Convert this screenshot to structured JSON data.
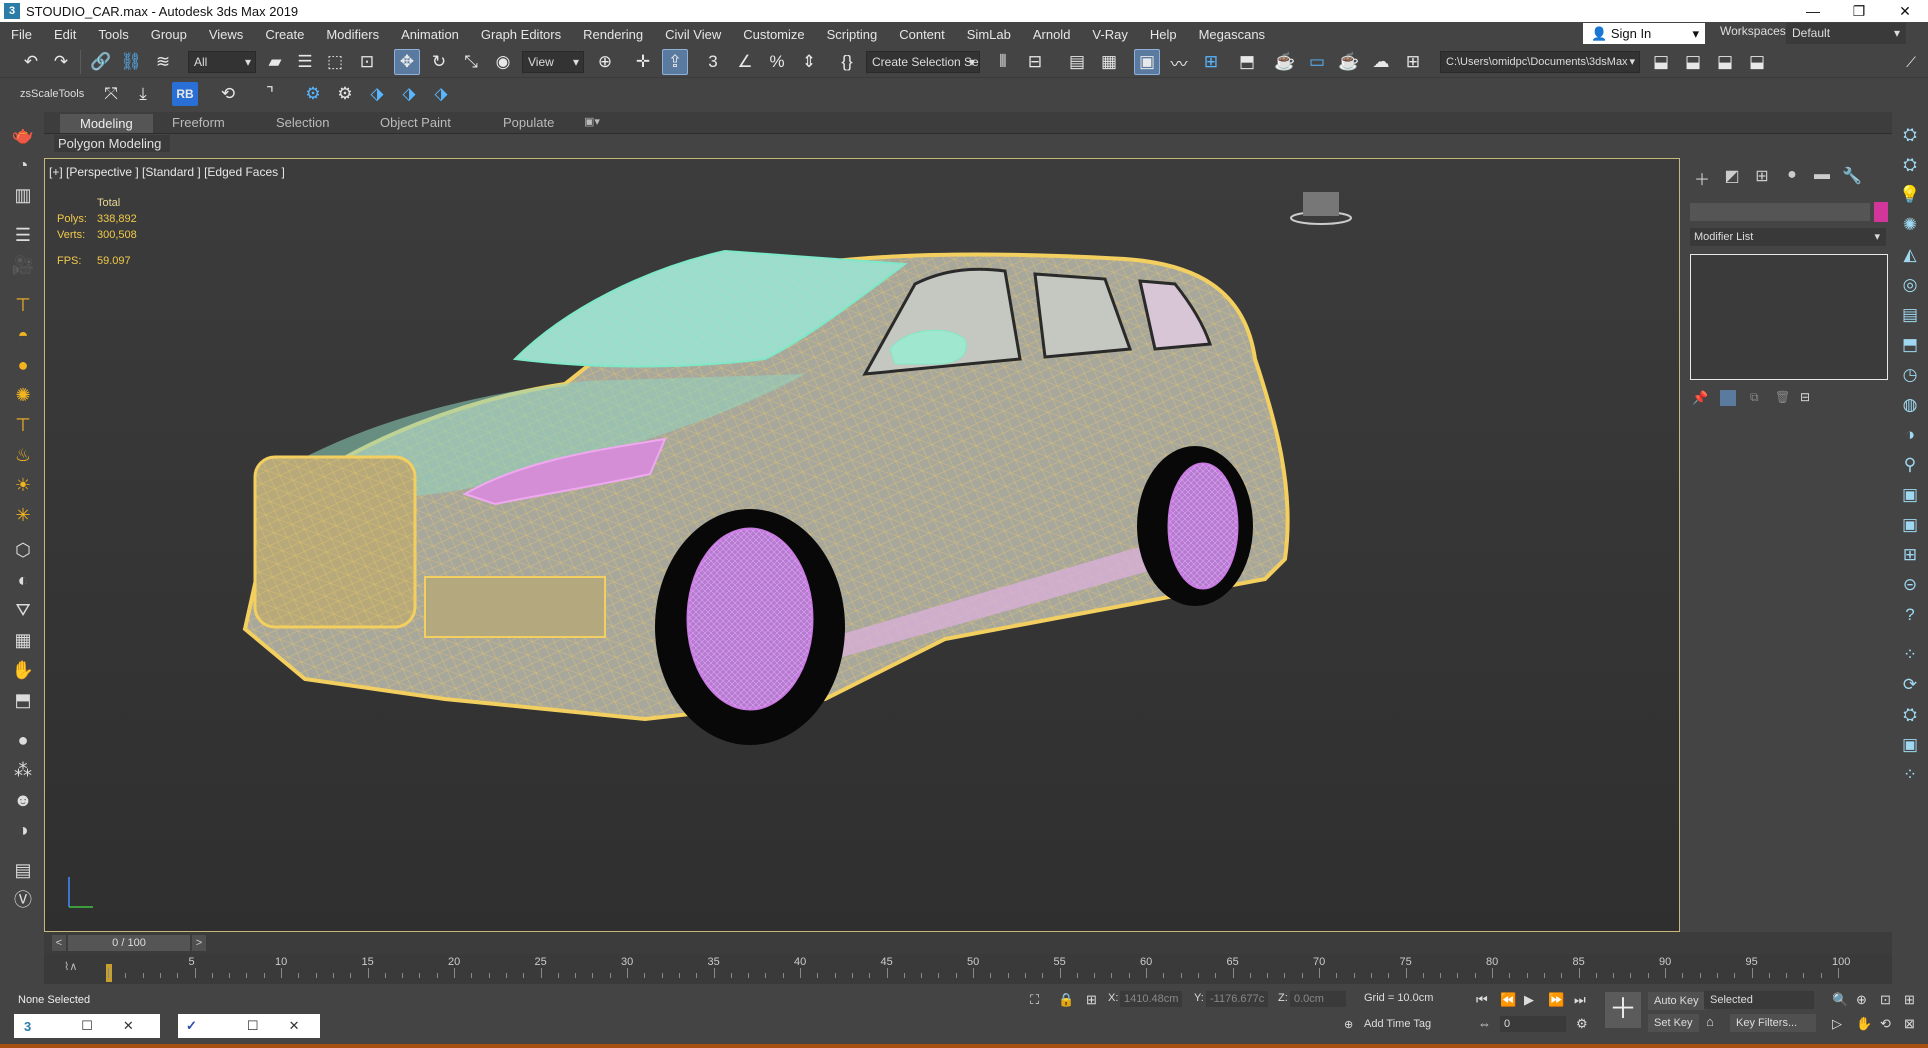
{
  "window": {
    "title": "STOUDIO_CAR.max - Autodesk 3ds Max 2019",
    "app_icon": "3"
  },
  "menu": [
    "File",
    "Edit",
    "Tools",
    "Group",
    "Views",
    "Create",
    "Modifiers",
    "Animation",
    "Graph Editors",
    "Rendering",
    "Civil View",
    "Customize",
    "Scripting",
    "Content",
    "SimLab",
    "Arnold",
    "V-Ray",
    "Help",
    "Megascans"
  ],
  "signin": "Sign In",
  "workspaces": {
    "label": "Workspaces:",
    "value": "Default"
  },
  "toolbar": {
    "selection_filter": "All",
    "ref_coord": "View",
    "named_selection": "Create Selection Se",
    "project_path": "C:\\Users\\omidpc\\Documents\\3dsMax",
    "zs_label": "zsScaleTools",
    "rb_label": "RB"
  },
  "ribbon": {
    "tabs": [
      "Modeling",
      "Freeform",
      "Selection",
      "Object Paint",
      "Populate"
    ],
    "active": "Modeling",
    "panel": "Polygon Modeling"
  },
  "viewport": {
    "label": "[+] [Perspective ] [Standard ] [Edged Faces ]",
    "stats_header": "Total",
    "polys_label": "Polys:",
    "polys": "338,892",
    "verts_label": "Verts:",
    "verts": "300,508",
    "fps_label": "FPS:",
    "fps": "59.097"
  },
  "command_panel": {
    "modifier_list": "Modifier List",
    "object_color": "#d3369a"
  },
  "timeslider": {
    "frame": "0 / 100",
    "prev": "<",
    "next": ">"
  },
  "trackbar": {
    "ticks": [
      "5",
      "10",
      "15",
      "20",
      "25",
      "30",
      "35",
      "40",
      "45",
      "50",
      "55",
      "60",
      "65",
      "70",
      "75",
      "80",
      "85",
      "90",
      "95",
      "100"
    ]
  },
  "status": {
    "selection": "None Selected",
    "x_label": "X:",
    "x": "1410.48cm",
    "y_label": "Y:",
    "y": "-1176.677c",
    "z_label": "Z:",
    "z": "0.0cm",
    "grid": "Grid = 10.0cm",
    "add_time_tag": "Add Time Tag",
    "auto_key": "Auto Key",
    "key_mode": "Selected",
    "set_key": "Set Key",
    "key_filters": "Key Filters...",
    "frame_field": "0"
  },
  "colors": {
    "wire_body": "#f3cf5f",
    "wire_glass": "#7fe8c8",
    "wire_pink": "#e88ee8",
    "wheel": "#c77ae0",
    "viewport_border": "#c8b77a"
  }
}
